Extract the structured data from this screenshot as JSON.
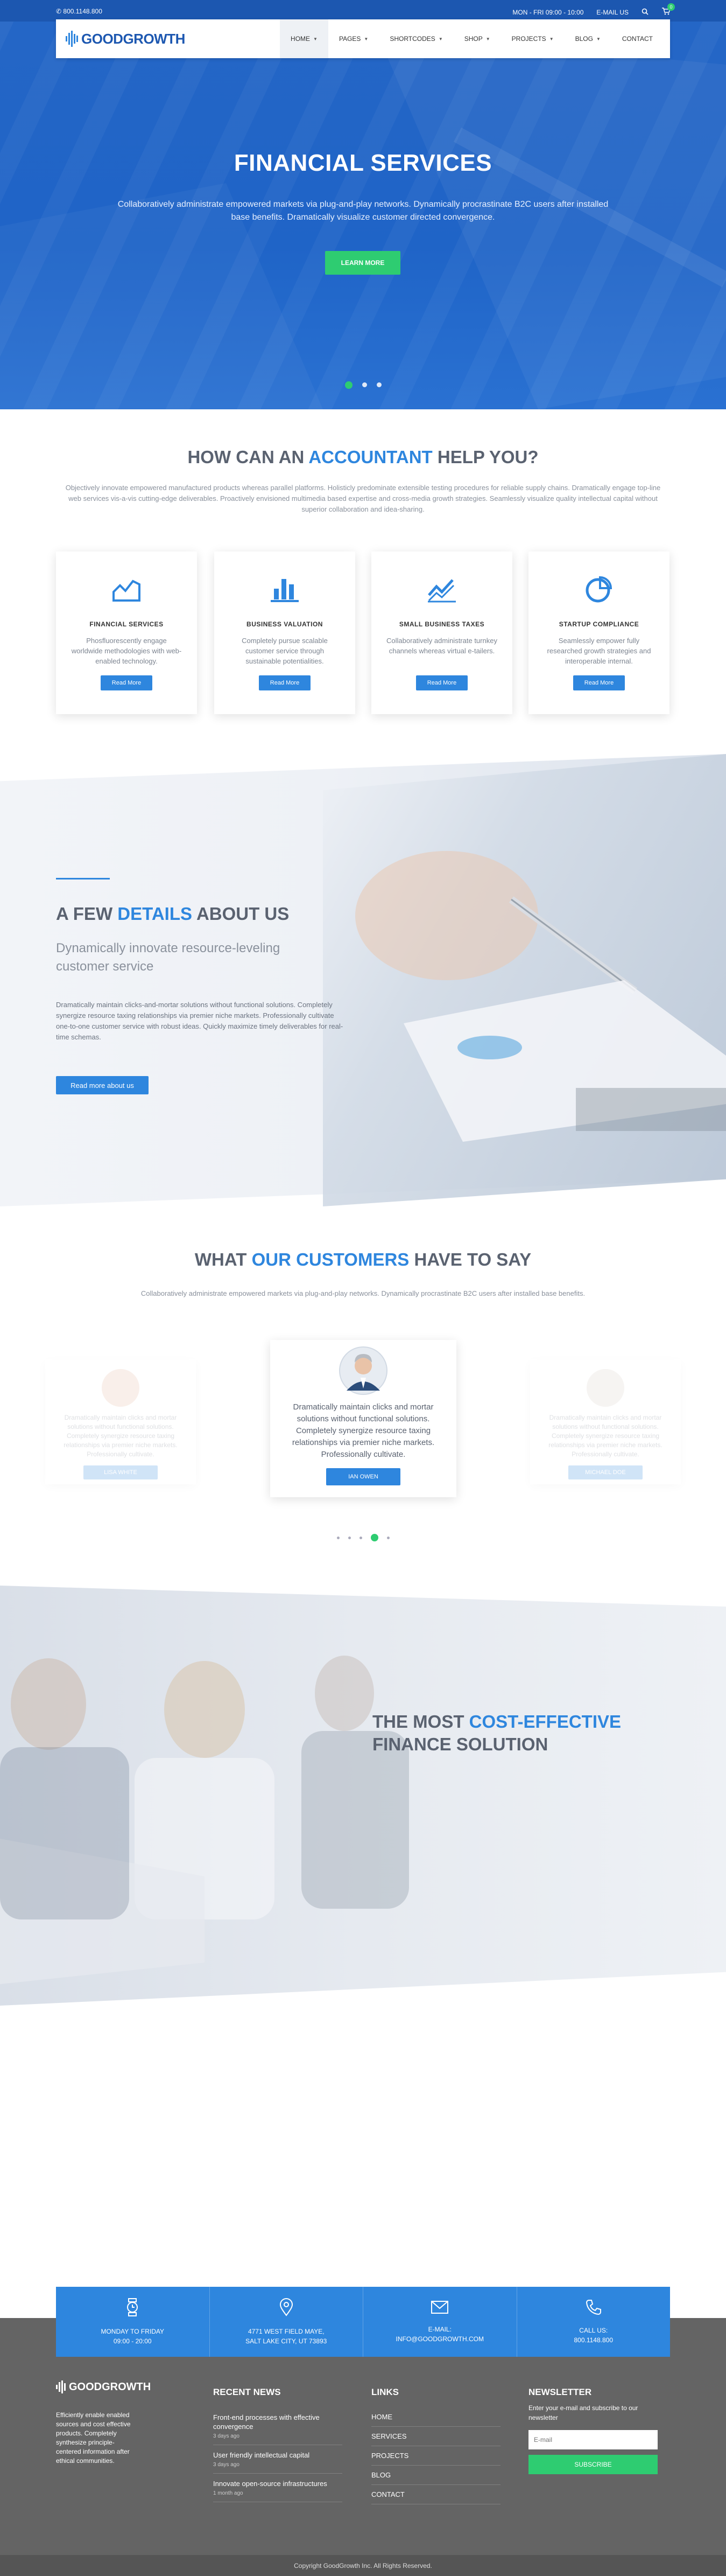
{
  "topbar": {
    "phone": "800.1148.800",
    "hours": "MON - FRI 09:00 - 10:00",
    "email_label": "E-MAIL US",
    "cart_count": "0"
  },
  "brand": {
    "name": "GOODGROWTH",
    "accent": "#2e86de",
    "green": "#2ecc71",
    "dark_blue": "#1c57b0"
  },
  "menu": [
    {
      "label": "HOME",
      "caret": true,
      "active": true
    },
    {
      "label": "PAGES",
      "caret": true
    },
    {
      "label": "SHORTCODES",
      "caret": true
    },
    {
      "label": "SHOP",
      "caret": true
    },
    {
      "label": "PROJECTS",
      "caret": true
    },
    {
      "label": "BLOG",
      "caret": true
    },
    {
      "label": "CONTACT",
      "caret": false
    }
  ],
  "hero": {
    "title": "FINANCIAL SERVICES",
    "text": "Collaboratively administrate empowered markets via plug-and-play networks. Dynamically procrastinate B2C users after installed base benefits. Dramatically visualize customer directed convergence.",
    "button": "LEARN MORE",
    "active_slide": 1
  },
  "services": {
    "title_pre": "HOW CAN AN ",
    "title_hl": "ACCOUNTANT",
    "title_post": " HELP YOU?",
    "lead": "Objectively innovate empowered manufactured products whereas parallel platforms. Holisticly predominate extensible testing procedures for reliable supply chains. Dramatically engage top-line web services vis-a-vis cutting-edge deliverables. Proactively envisioned multimedia based expertise and cross-media growth strategies. Seamlessly visualize quality intellectual capital without superior collaboration and idea-sharing.",
    "cards": [
      {
        "title": "FINANCIAL SERVICES",
        "text": "Phosfluorescently engage worldwide methodologies with web-enabled technology.",
        "button": "Read More",
        "icon": "area-chart-icon"
      },
      {
        "title": "BUSINESS VALUATION",
        "text": "Completely pursue scalable customer service through sustainable potentialities.",
        "button": "Read More",
        "icon": "bar-chart-icon"
      },
      {
        "title": "SMALL BUSINESS TAXES",
        "text": "Collaboratively administrate turnkey channels whereas virtual e-tailers.",
        "button": "Read More",
        "icon": "line-chart-icon"
      },
      {
        "title": "STARTUP COMPLIANCE",
        "text": "Seamlessly empower fully researched growth strategies and interoperable internal.",
        "button": "Read More",
        "icon": "pie-chart-icon"
      }
    ]
  },
  "about": {
    "title_pre": "A FEW ",
    "title_hl": "DETAILS",
    "title_post": " ABOUT US",
    "subtitle": "Dynamically innovate resource-leveling customer service",
    "text": "Dramatically maintain clicks-and-mortar solutions without functional solutions. Completely synergize resource taxing relationships via premier niche markets. Professionally cultivate one-to-one customer service with robust ideas. Quickly maximize timely deliverables for real-time schemas.",
    "button": "Read more about us"
  },
  "testimonials": {
    "title_pre": "WHAT ",
    "title_hl": "OUR CUSTOMERS",
    "title_post": " HAVE TO SAY",
    "lead": "Collaboratively administrate empowered markets via plug-and-play networks. Dynamically procrastinate B2C users after installed base benefits.",
    "items": [
      {
        "text": "Dramatically maintain clicks and mortar solutions without functional solutions. Completely synergize resource taxing relationships via premier niche markets. Professionally cultivate.",
        "name": "LISA WHITE"
      },
      {
        "text": "Dramatically maintain clicks and mortar solutions without functional solutions. Completely synergize resource taxing relationships via premier niche markets. Professionally cultivate.",
        "name": "IAN OWEN"
      },
      {
        "text": "Dramatically maintain clicks and mortar solutions without functional solutions. Completely synergize resource taxing relationships via premier niche markets. Professionally cultivate.",
        "name": "MICHAEL DOE"
      }
    ],
    "active_index": 3
  },
  "cost": {
    "line1_pre": "THE MOST ",
    "line1_hl": "COST-EFFECTIVE",
    "line2": "FINANCE SOLUTION"
  },
  "contact": [
    {
      "icon": "clock-icon",
      "l1": "MONDAY TO FRIDAY",
      "l2": "09:00 - 20:00"
    },
    {
      "icon": "map-pin-icon",
      "l1": "4771 WEST FIELD MAYE,",
      "l2": "SALT LAKE CITY, UT 73893"
    },
    {
      "icon": "envelope-icon",
      "l1": "E-MAIL:",
      "l2": "INFO@GOODGROWTH.COM"
    },
    {
      "icon": "phone-icon",
      "l1": "CALL US:",
      "l2": "800.1148.800"
    }
  ],
  "footer": {
    "about": "Efficiently enable enabled sources and cost effective products. Completely synthesize principle-centered information after ethical communities.",
    "news_title": "RECENT NEWS",
    "news": [
      {
        "title": "Front-end processes with effective convergence",
        "date": "3 days ago"
      },
      {
        "title": "User friendly intellectual capital",
        "date": "3 days ago"
      },
      {
        "title": "Innovate open-source infrastructures",
        "date": "1 month ago"
      }
    ],
    "links_title": "LINKS",
    "links": [
      "HOME",
      "SERVICES",
      "PROJECTS",
      "BLOG",
      "CONTACT"
    ],
    "newsletter_title": "NEWSLETTER",
    "newsletter_text": "Enter your e-mail and subscribe to our newsletter",
    "email_placeholder": "E-mail",
    "subscribe": "SUBSCRIBE",
    "copyright": "Copyright GoodGrowth Inc. All Rights Reserved."
  }
}
